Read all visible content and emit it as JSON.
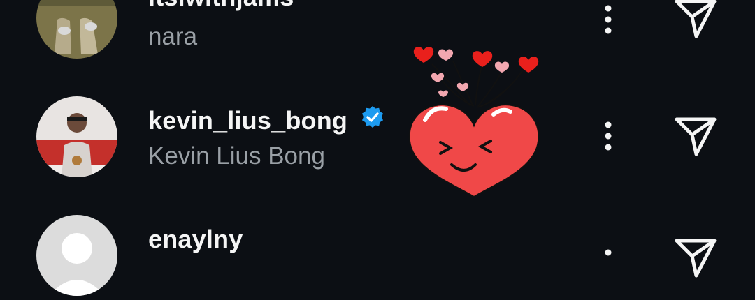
{
  "users": [
    {
      "username": "itsiwithjams",
      "name": "nara",
      "verified": false
    },
    {
      "username": "kevin_lius_bong",
      "name": "Kevin Lius Bong",
      "verified": true
    },
    {
      "username": "enaylny",
      "name": "",
      "verified": false
    }
  ],
  "icons": {
    "more": "three-dots-vertical-icon",
    "send": "paper-plane-icon",
    "verified": "verified-badge-icon"
  },
  "colors": {
    "background": "#0c0f14",
    "username": "#f5f5f5",
    "subname": "#9aa0a6",
    "verified": "#1d9bf0",
    "heart": "#f04848"
  }
}
